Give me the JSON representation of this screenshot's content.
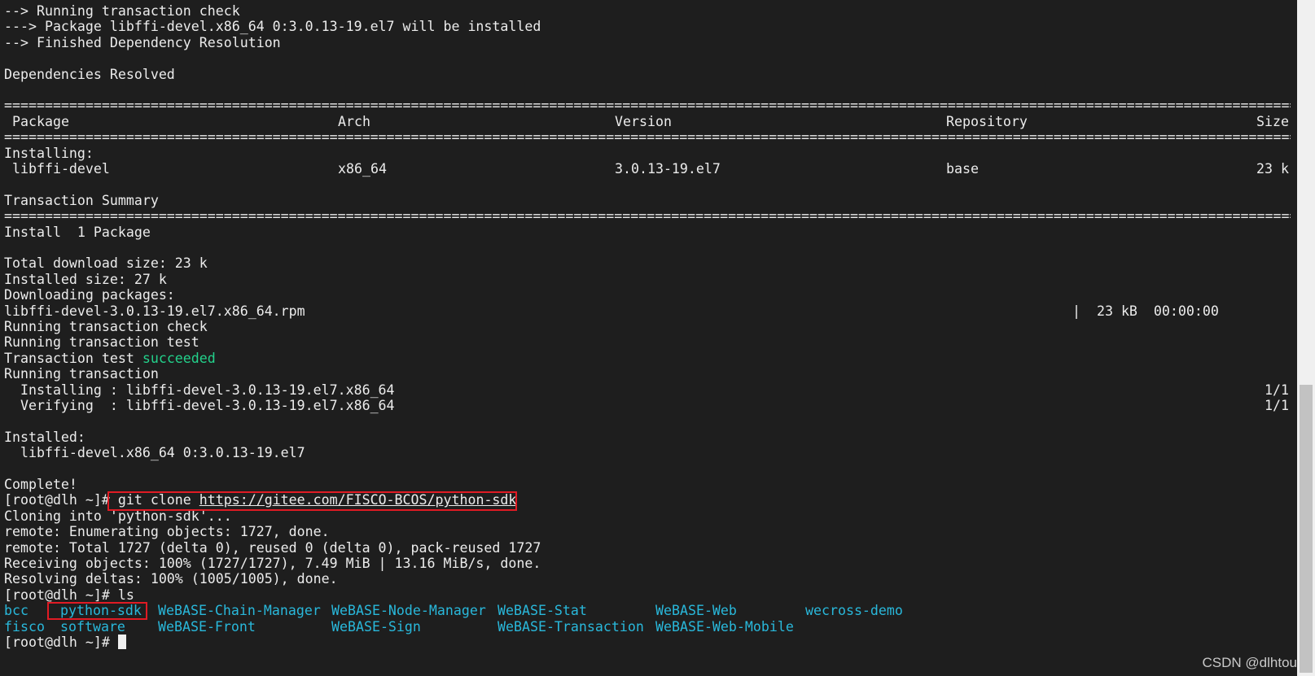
{
  "terminal": {
    "pre_lines": [
      "--> Running transaction check",
      "---> Package libffi-devel.x86_64 0:3.0.13-19.el7 will be installed",
      "--> Finished Dependency Resolution",
      "",
      "Dependencies Resolved"
    ],
    "table": {
      "headers": [
        "Package",
        "Arch",
        "Version",
        "Repository",
        "Size"
      ],
      "section_label": "Installing:",
      "rows": [
        [
          "libffi-devel",
          "x86_64",
          "3.0.13-19.el7",
          "base",
          "23 k"
        ]
      ]
    },
    "transaction_summary": "Transaction Summary",
    "install_line": "Install  1 Package",
    "post_lines": [
      "Total download size: 23 k",
      "Installed size: 27 k",
      "Downloading packages:"
    ],
    "download": {
      "file": "libffi-devel-3.0.13-19.el7.x86_64.rpm",
      "progress": "|  23 kB  00:00:00"
    },
    "running_check": "Running transaction check",
    "running_test": "Running transaction test",
    "test_prefix": "Transaction test ",
    "test_status": "succeeded",
    "running_transaction": "Running transaction",
    "steps": [
      {
        "text": "  Installing : libffi-devel-3.0.13-19.el7.x86_64",
        "count": "1/1"
      },
      {
        "text": "  Verifying  : libffi-devel-3.0.13-19.el7.x86_64",
        "count": "1/1"
      }
    ],
    "installed_label": "Installed:",
    "installed_pkg": "  libffi-devel.x86_64 0:3.0.13-19.el7",
    "complete": "Complete!",
    "prompt": "[root@dlh ~]#",
    "git_cmd_prefix": " git clone ",
    "git_url": "https://gitee.com/FISCO-BCOS/python-sdk",
    "clone_lines": [
      "Cloning into 'python-sdk'...",
      "remote: Enumerating objects: 1727, done.",
      "remote: Total 1727 (delta 0), reused 0 (delta 0), pack-reused 1727",
      "Receiving objects: 100% (1727/1727), 7.49 MiB | 13.16 MiB/s, done.",
      "Resolving deltas: 100% (1005/1005), done."
    ],
    "ls_cmd": " ls",
    "ls_row1": [
      "bcc",
      "python-sdk",
      "WeBASE-Chain-Manager",
      "WeBASE-Node-Manager",
      "WeBASE-Stat",
      "WeBASE-Web",
      "wecross-demo"
    ],
    "ls_row2": [
      "fisco",
      "software",
      "WeBASE-Front",
      "WeBASE-Sign",
      "WeBASE-Transaction",
      "WeBASE-Web-Mobile"
    ]
  },
  "watermark": "CSDN @dlhtou",
  "colors": {
    "background": "#1e1e1e",
    "text": "#ececec",
    "success": "#23d18b",
    "directory": "#29b8db",
    "highlight_box": "#e01b24"
  }
}
